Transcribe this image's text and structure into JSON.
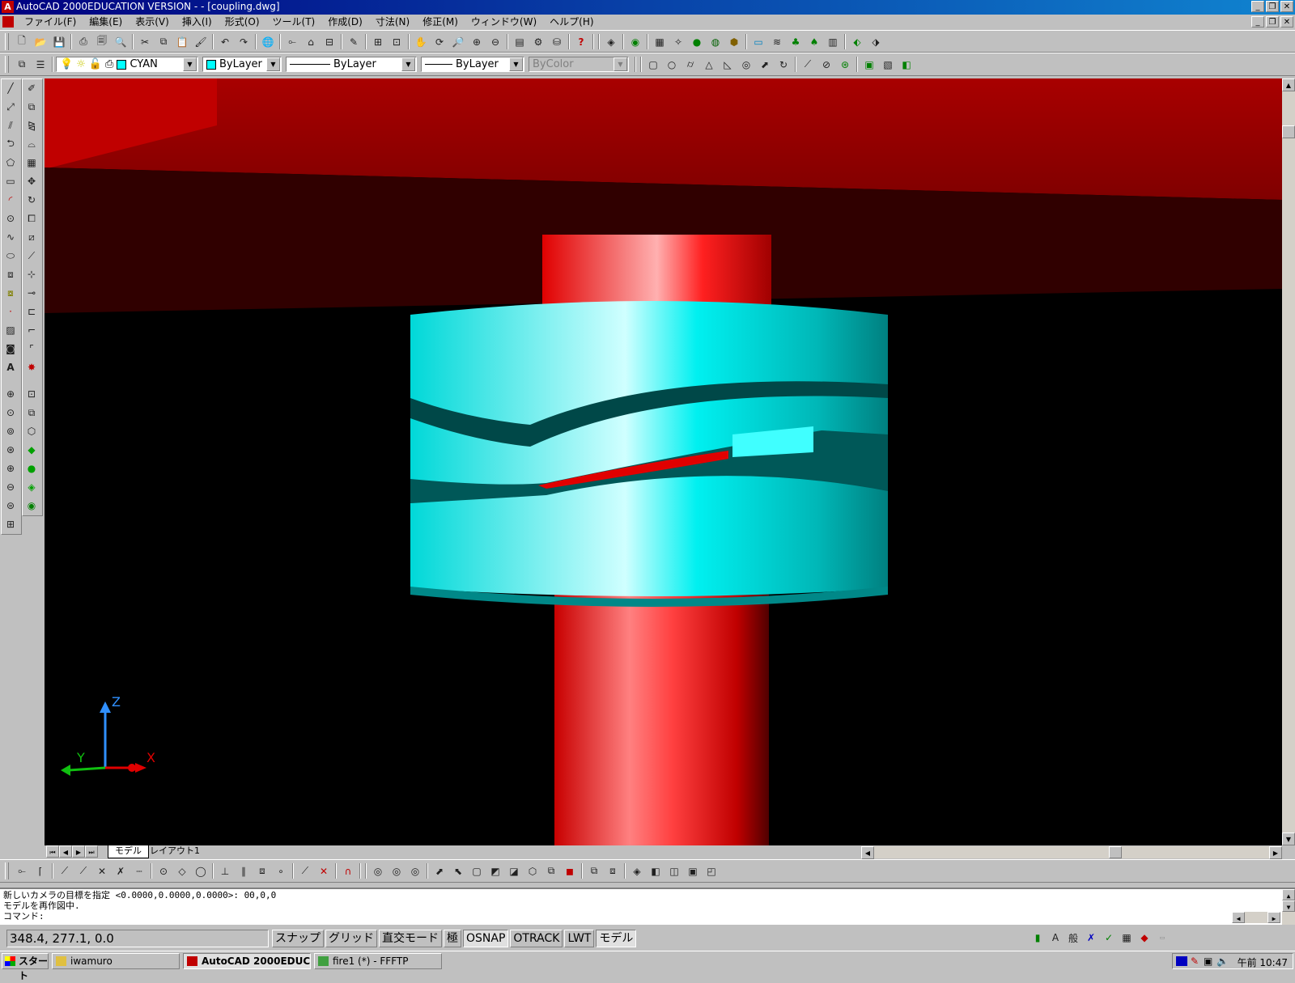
{
  "window": {
    "title": "AutoCAD 2000EDUCATION VERSION - - [coupling.dwg]"
  },
  "menu": [
    "ファイル(F)",
    "編集(E)",
    "表示(V)",
    "挿入(I)",
    "形式(O)",
    "ツール(T)",
    "作成(D)",
    "寸法(N)",
    "修正(M)",
    "ウィンドウ(W)",
    "ヘルプ(H)"
  ],
  "properties": {
    "layer": "CYAN",
    "color": "ByLayer",
    "linetype": "ByLayer",
    "lineweight": "ByLayer",
    "plotstyle": "ByColor"
  },
  "ucs": {
    "x": "X",
    "y": "Y",
    "z": "Z"
  },
  "tabs": {
    "model": "モデル",
    "layout1": "レイアウト1"
  },
  "command": {
    "lines": [
      "新しいカメラの目標を指定 <0.0000,0.0000,0.0000>: 00,0,0",
      "モデルを再作図中.",
      "コマンド:"
    ]
  },
  "status": {
    "coords": "348.4, 277.1, 0.0",
    "modes": [
      "スナップ",
      "グリッド",
      "直交モード",
      "極",
      "OSNAP",
      "OTRACK",
      "LWT",
      "モデル"
    ]
  },
  "taskbar": {
    "start": "スタート",
    "tasks": [
      "iwamuro",
      "AutoCAD 2000EDUC...",
      "fire1 (*) - FFFTP"
    ],
    "clock": "午前 10:47"
  },
  "colors": {
    "shaft": "#e00000",
    "coupling": "#00f0f0",
    "ceiling": "#c00000"
  }
}
